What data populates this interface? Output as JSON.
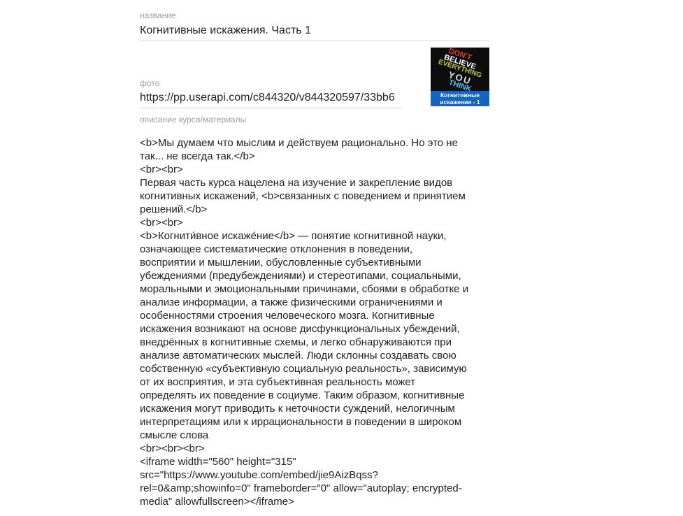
{
  "form": {
    "title_label": "название",
    "title_value": "Когнитивные искажения. Часть 1",
    "photo_label": "фото",
    "photo_value": "https://pp.userapi.com/c844320/v844320597/33bb6",
    "photo_thumb": {
      "lines": [
        "DON'T",
        "BELIEVE",
        "EVERYTHING",
        "YOU",
        "THINK"
      ],
      "caption": "Когнитивные искажения - 1"
    },
    "description_label": "описание курса/материалы",
    "description_lines": [
      "<b>Мы думаем что мыслим и действуем рационально. Но это не",
      "так... не всегда так.</b>",
      "<br><br>",
      "Первая часть курса нацелена на изучение и закрепление видов",
      "когнитивных искажений, <b>связанных с поведением и принятием",
      "решений.</b>",
      "<br><br>",
      "<b>Когнити́вное искаже́ние</b> — понятие когнитивной науки,",
      "означающее систематические отклонения в поведении,",
      "восприятии и мышлении, обусловленные субъективными",
      "убеждениями (предубеждениями) и стереотипами, социальными,",
      "моральными и эмоциональными причинами, сбоями в обработке и",
      "анализе информации, а также физическими ограничениями и",
      "особенностями строения человеческого мозга. Когнитивные",
      "искажения возникают на основе дисфункциональных убеждений,",
      "внедрённых в когнитивные схемы, и легко обнаруживаются при",
      "анализе автоматических мыслей. Люди склонны создавать свою",
      "собственную «субъективную социальную реальность», зависимую",
      "от их восприятия, и эта субъективная реальность может",
      "определять их поведение в социуме. Таким образом, когнитивные",
      "искажения могут приводить к неточности суждений, нелогичным",
      "интерпретациям или к иррациональности в поведении в широком",
      "смысле слова",
      "<br><br><br>",
      "<iframe width=\"560\" height=\"315\"",
      "src=\"https://www.youtube.com/embed/jie9AizBqss?",
      "rel=0&amp;showinfo=0\" frameborder=\"0\" allow=\"autoplay; encrypted-",
      "media\" allowfullscreen></iframe>"
    ]
  }
}
